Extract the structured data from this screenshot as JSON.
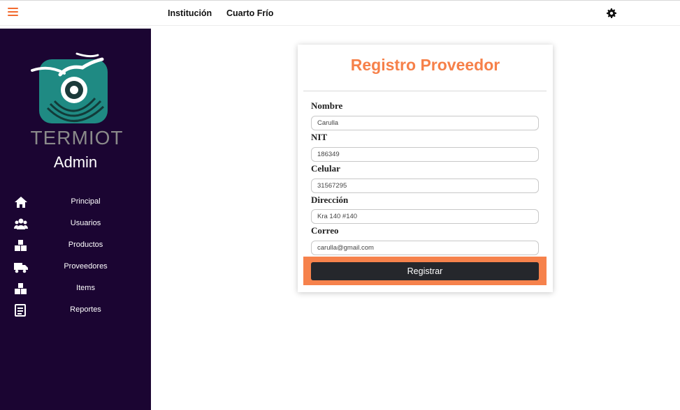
{
  "topbar": {
    "menu_icon": "hamburger-icon",
    "links": [
      "Institución",
      "Cuarto Frío"
    ],
    "settings_icon": "gear-icon"
  },
  "sidebar": {
    "logo_text": "TERMIOT",
    "role": "Admin",
    "items": [
      {
        "label": "Principal",
        "icon": "home-icon"
      },
      {
        "label": "Usuarios",
        "icon": "users-icon"
      },
      {
        "label": "Productos",
        "icon": "boxes-icon"
      },
      {
        "label": "Proveedores",
        "icon": "truck-icon"
      },
      {
        "label": "Items",
        "icon": "boxes-icon"
      },
      {
        "label": "Reportes",
        "icon": "report-icon"
      }
    ]
  },
  "form": {
    "title": "Registro Proveedor",
    "fields": [
      {
        "label": "Nombre",
        "value": "Carulla"
      },
      {
        "label": "NIT",
        "value": "186349"
      },
      {
        "label": "Celular",
        "value": "31567295"
      },
      {
        "label": "Dirección",
        "value": "Kra 140 #140"
      },
      {
        "label": "Correo",
        "value": "carulla@gmail.com"
      }
    ],
    "submit_label": "Registrar"
  },
  "colors": {
    "accent": "#f68049",
    "sidebar_bg": "#1b0532",
    "button_bg": "#25272c",
    "logo_teal": "#1f8a83"
  }
}
